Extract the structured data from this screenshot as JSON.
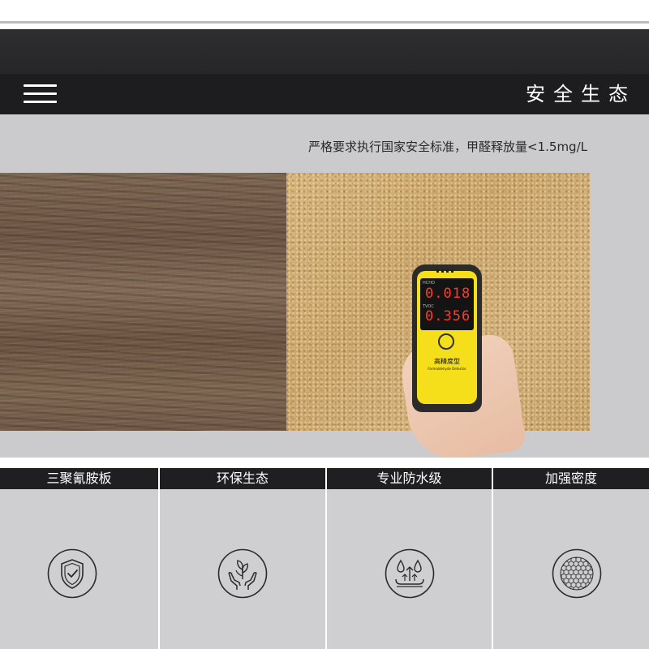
{
  "header": {
    "title": "安全生态"
  },
  "hero": {
    "caption": "严格要求执行国家安全标准，甲醛释放量<1.5mg/L",
    "device": {
      "reading_1_tag": "HCHO",
      "reading_1": "0.018",
      "reading_2_tag": "TVOC",
      "reading_2": "0.356",
      "label": "高精度型",
      "sublabel": "Formaldehyde Detector"
    }
  },
  "features": [
    {
      "label": "三聚氰胺板",
      "icon": "shield-check-icon"
    },
    {
      "label": "环保生态",
      "icon": "hands-plant-icon"
    },
    {
      "label": "专业防水级",
      "icon": "water-drops-icon"
    },
    {
      "label": "加强密度",
      "icon": "hexagon-mesh-icon"
    }
  ],
  "colors": {
    "nav_bg": "#1d1d1f",
    "hero_bg": "#cbcacc",
    "feature_bg": "#cfced0",
    "feature_head_bg": "#1f1f21",
    "device_yellow": "#f5de1a",
    "readout_red": "#ff3a2a"
  }
}
